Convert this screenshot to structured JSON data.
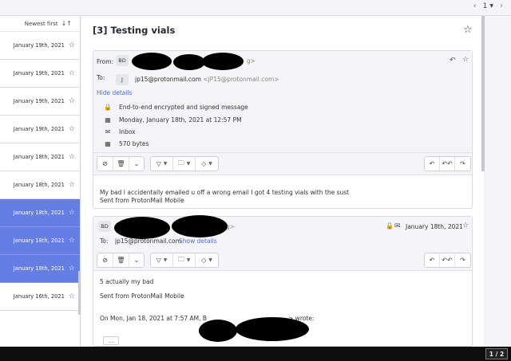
{
  "pager": {
    "current": "1",
    "prev_icon": "chevron-left-icon",
    "next_icon": "chevron-right-icon"
  },
  "list": {
    "sort_label": "Newest first",
    "sort_icon": "sort-icon",
    "rows": [
      {
        "date": "January 19th, 2021",
        "selected": false
      },
      {
        "date": "January 19th, 2021",
        "selected": false
      },
      {
        "date": "January 19th, 2021",
        "selected": false
      },
      {
        "date": "January 19th, 2021",
        "selected": false
      },
      {
        "date": "January 18th, 2021",
        "selected": false
      },
      {
        "date": "January 18th, 2021",
        "selected": false
      },
      {
        "date": "January 18th, 2021",
        "selected": true
      },
      {
        "date": "January 18th, 2021",
        "selected": true
      },
      {
        "date": "January 18th, 2021",
        "selected": true
      },
      {
        "date": "January 16th, 2021",
        "selected": false
      }
    ]
  },
  "conversation": {
    "subject": "[3] Testing vials",
    "msg1": {
      "from_label": "From:",
      "from_initials": "BD",
      "from_tail": "g>",
      "to_label": "To:",
      "to_initial": "J",
      "to_addr": "jp15@protonmail.com",
      "to_addr_muted": "<jP15@protonmail.com>",
      "hide_details": "Hide details",
      "details": {
        "encryption": "End-to-end encrypted and signed message",
        "date": "Monday, January 18th, 2021 at 12:57 PM",
        "folder": "Inbox",
        "size": "570 bytes"
      },
      "body_line1": "My bad I accidentally emailed u off a wrong email I got 4 testing vials with the sust",
      "body_line2": "Sent from ProtonMail Mobile"
    },
    "msg2": {
      "from_initials": "BD",
      "from_tail": "g>",
      "date": "January 18th, 2021",
      "to_label": "To:",
      "to_addr": "jp15@protonmail.com",
      "show_details": "Show details",
      "body_line1": "5 actually my bad",
      "body_line2": "Sent from ProtonMail Mobile",
      "quote_prefix": "On Mon, Jan 18, 2021 at 7:57 AM, B",
      "quote_suffix": "> wrote:",
      "expand_label": "..."
    }
  },
  "page_indicator": "1 / 2",
  "colors": {
    "selected_row": "#657ee4",
    "link": "#4f6cd8",
    "bottom_bar": "#0e0e0e"
  }
}
